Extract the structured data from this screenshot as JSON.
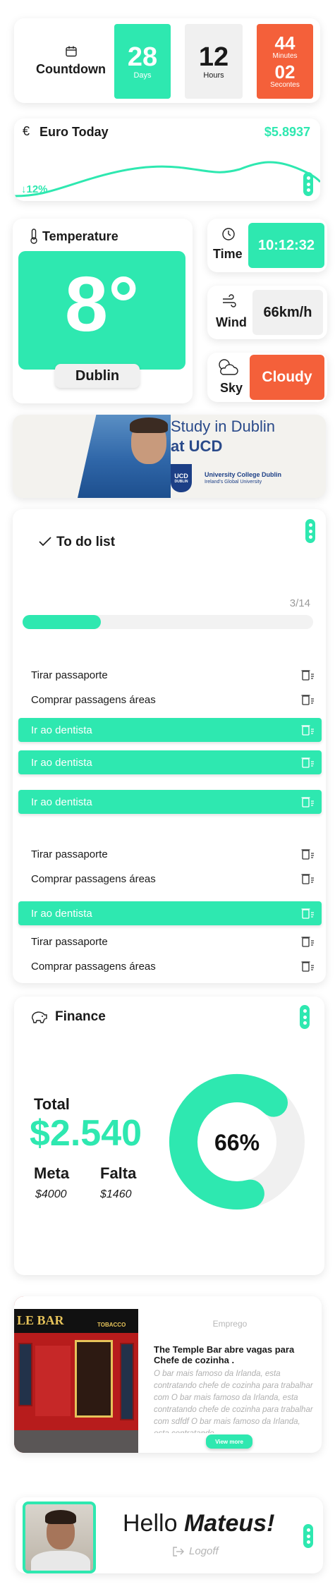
{
  "countdown": {
    "title": "Countdown",
    "days_value": "28",
    "days_label": "Days",
    "hours_value": "12",
    "hours_label": "Hours",
    "minutes_value": "44",
    "minutes_label": "Minutes",
    "seconds_value": "02",
    "seconds_label": "Secontes"
  },
  "euro": {
    "title": "Euro Today",
    "icon": "euro-icon",
    "value": "$5.8937",
    "change": "12%",
    "change_icon": "arrow-down-icon"
  },
  "weather": {
    "temperature_title": "Temperature",
    "temperature_value": "8°",
    "city": "Dublin",
    "time_label": "Time",
    "time_value": "10:12:32",
    "wind_label": "Wind",
    "wind_value": "66km/h",
    "sky_label": "Sky",
    "sky_value": "Cloudy"
  },
  "ad": {
    "line1": "Study in Dublin",
    "line2": "at UCD",
    "crest_text": "UCD",
    "crest_sub": "DUBLIN",
    "university": "University College Dublin",
    "tagline": "Ireland's Global University"
  },
  "todo": {
    "title": "To do list",
    "progress_text": "3/14",
    "progress_fraction": 0.27,
    "items": [
      {
        "label": "Tirar passaporte",
        "done": false
      },
      {
        "label": "Comprar passagens áreas",
        "done": false
      },
      {
        "label": "Ir ao dentista",
        "done": true
      },
      {
        "label": "Ir ao dentista",
        "done": true
      },
      {
        "label": "Ir ao dentista",
        "done": true
      },
      {
        "label": "Tirar passaporte",
        "done": false
      },
      {
        "label": "Comprar passagens áreas",
        "done": false
      },
      {
        "label": "Ir ao dentista",
        "done": true
      },
      {
        "label": "Tirar passaporte",
        "done": false
      },
      {
        "label": "Comprar passagens áreas",
        "done": false
      }
    ]
  },
  "finance": {
    "title": "Finance",
    "total_label": "Total",
    "total_value": "$2.540",
    "meta_label": "Meta",
    "meta_value": "$4000",
    "falta_label": "Falta",
    "falta_value": "$1460",
    "percent_text": "66%",
    "percent_value": 66
  },
  "job": {
    "category": "Emprego",
    "headline": "The Temple Bar abre vagas para Chefe de cozinha .",
    "body": "O bar mais famoso da Irlanda, esta contratando chefe de cozinha para trabalhar com O bar mais famoso da Irlanda, esta contratando chefe de cozinha para trabalhar com sdfdf O bar mais famoso da Irlanda, esta contratando ...",
    "button": "View more",
    "sign_bar": "LE BAR",
    "sign_tobacco": "TOBACCO"
  },
  "user": {
    "greeting": "Hello",
    "name": "Mateus!",
    "logoff": "Logoff"
  },
  "colors": {
    "accent": "#2ee8b0",
    "orange": "#f4603a",
    "grey": "#f0f0f0"
  }
}
